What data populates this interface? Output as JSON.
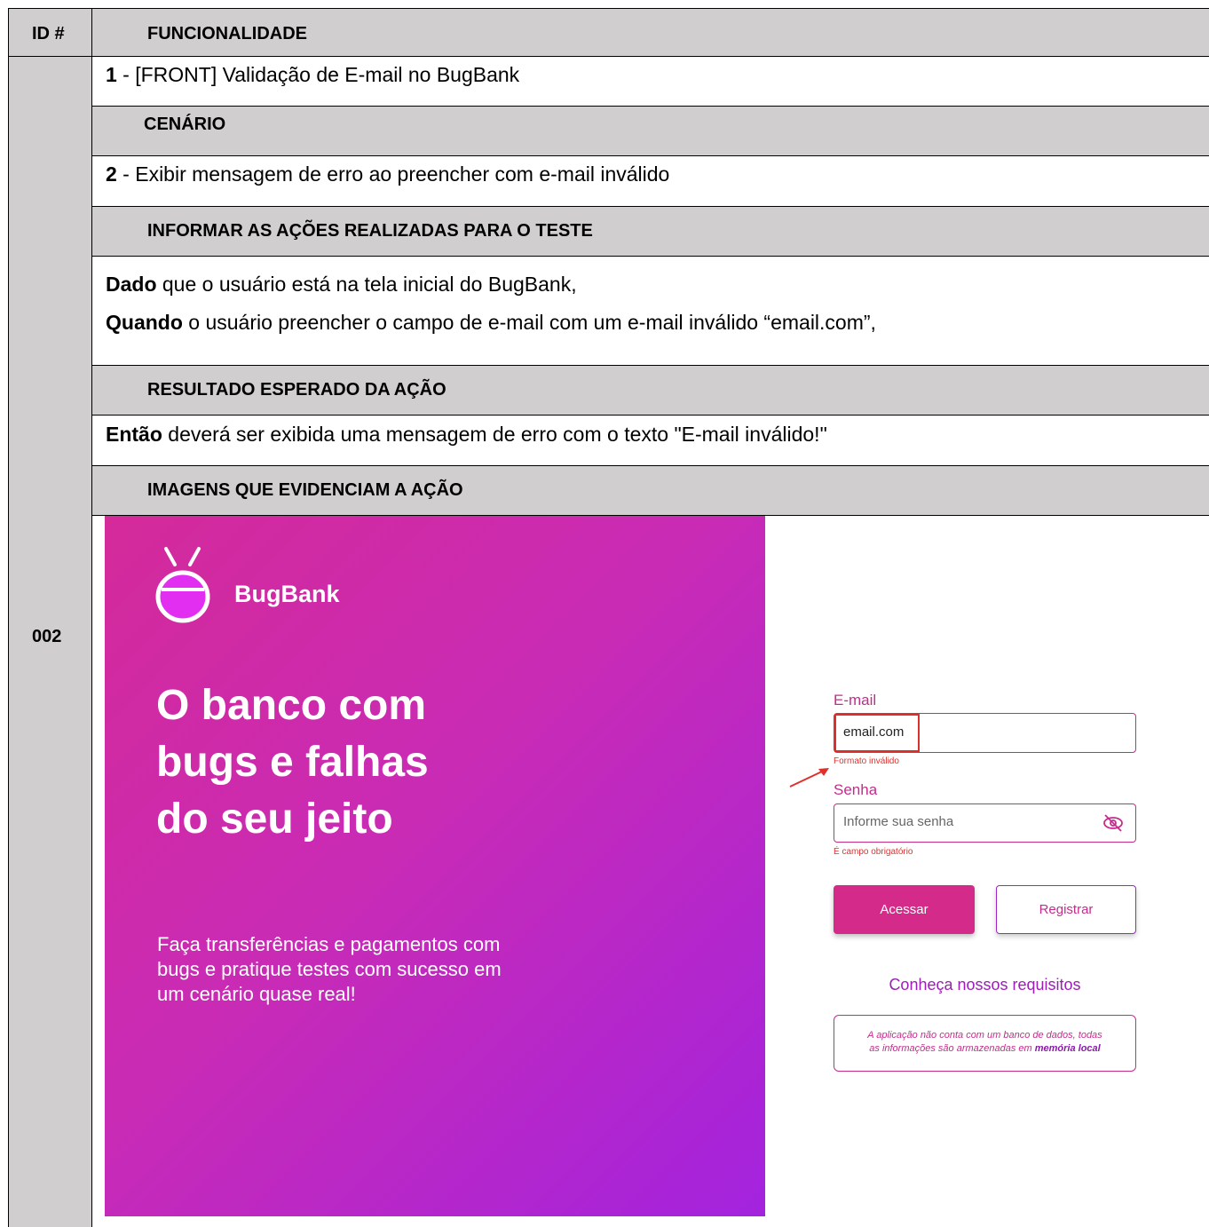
{
  "table": {
    "header_id": "ID #",
    "header_func": "FUNCIONALIDADE",
    "id_value": "002",
    "func_num": "1",
    "func_text": " - [FRONT] Validação de E-mail no BugBank",
    "cenario_header": "CENÁRIO",
    "cenario_num": "2",
    "cenario_text": " - Exibir mensagem de erro ao preencher com e-mail inválido",
    "acoes_header": "INFORMAR AS AÇÕES REALIZADAS PARA O TESTE",
    "dado_bold": "Dado",
    "dado_text": " que o usuário está na tela inicial do BugBank,",
    "quando_bold": "Quando",
    "quando_text": " o usuário preencher o campo de e-mail com um e-mail inválido “email.com”,",
    "resultado_header": "RESULTADO ESPERADO DA AÇÃO",
    "entao_bold": "Então",
    "entao_text": " deverá ser exibida uma mensagem de erro com o texto \"E-mail inválido!\"",
    "imagens_header": "IMAGENS QUE EVIDENCIAM A AÇÃO"
  },
  "screenshot": {
    "brand": "BugBank",
    "hero_line1": "O banco com",
    "hero_line2": "bugs e falhas",
    "hero_line3": "do seu jeito",
    "sub_line1": "Faça transferências e pagamentos com",
    "sub_line2": "bugs e pratique testes com sucesso em",
    "sub_line3": "um cenário quase real!",
    "email_label": "E-mail",
    "email_value": "email.com",
    "email_error": "Formato inválido",
    "senha_label": "Senha",
    "senha_placeholder": "Informe sua senha",
    "senha_error": "É campo obrigatório",
    "acessar_label": "Acessar",
    "registrar_label": "Registrar",
    "requisitos_link": "Conheça nossos requisitos",
    "info_line1": "A aplicação não conta com um banco de dados, todas",
    "info_line2_prefix": "as informações são armazenadas em ",
    "info_line2_bold": "memória local",
    "colors": {
      "brand_pink": "#c42c8c",
      "button_pink": "#d42a8a",
      "error_red": "#e0302e",
      "header_gray": "#d0cece"
    }
  }
}
